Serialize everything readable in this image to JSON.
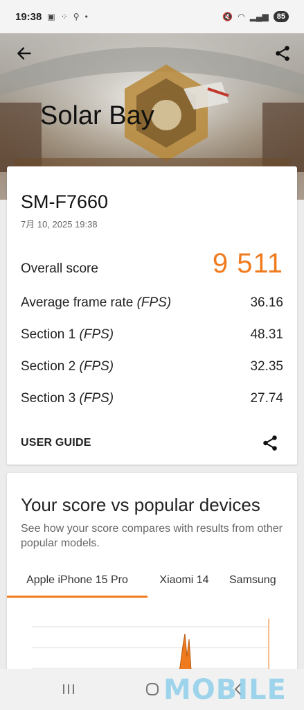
{
  "status_bar": {
    "time": "19:38",
    "battery": "85"
  },
  "header": {
    "title": "Solar Bay"
  },
  "result": {
    "device_name": "SM-F7660",
    "date": "7月 10, 2025 19:38",
    "overall_label": "Overall score",
    "overall_value": "9 511",
    "rows": [
      {
        "label": "Average frame rate",
        "unit": "(FPS)",
        "value": "36.16"
      },
      {
        "label": "Section 1",
        "unit": "(FPS)",
        "value": "48.31"
      },
      {
        "label": "Section 2",
        "unit": "(FPS)",
        "value": "32.35"
      },
      {
        "label": "Section 3",
        "unit": "(FPS)",
        "value": "27.74"
      }
    ],
    "user_guide": "USER GUIDE"
  },
  "compare": {
    "title": "Your score vs popular devices",
    "description": "See how your score compares with results from other popular models.",
    "tabs": [
      "Apple iPhone 15 Pro",
      "Xiaomi 14",
      "Samsung"
    ],
    "active_tab": 0
  },
  "watermark": "MOBILE",
  "colors": {
    "accent": "#f07b1e",
    "card": "#ffffff",
    "background": "#ececec"
  }
}
